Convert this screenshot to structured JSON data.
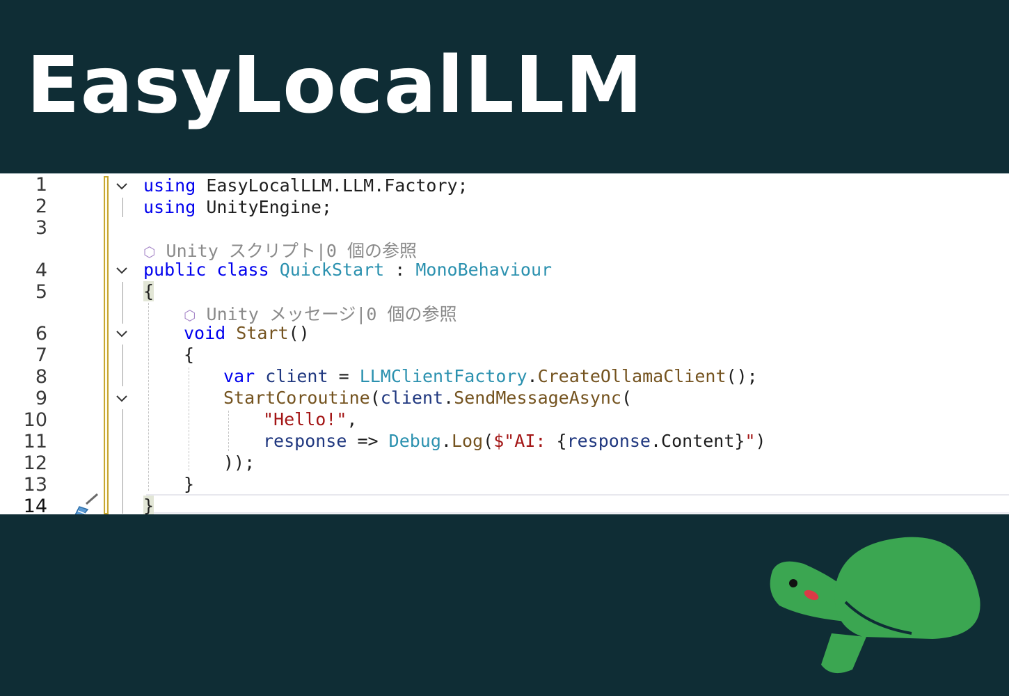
{
  "banner": {
    "title": "EasyLocalLLM"
  },
  "editor": {
    "line_numbers": [
      "1",
      "2",
      "3",
      "4",
      "5",
      "6",
      "7",
      "8",
      "9",
      "10",
      "11",
      "12",
      "13",
      "14"
    ],
    "lens": {
      "class_refs": "Unity スクリプト|0 個の参照",
      "method_refs": "Unity メッセージ|0 個の参照"
    },
    "code": {
      "l1": {
        "kw": "using",
        "rest": " EasyLocalLLM.LLM.Factory;"
      },
      "l2": {
        "kw": "using",
        "rest": " UnityEngine;"
      },
      "l4": {
        "kw1": "public",
        "kw2": "class",
        "cls": "QuickStart",
        "colon": " : ",
        "base": "MonoBehaviour"
      },
      "l5": {
        "brace": "{"
      },
      "l6": {
        "kw": "void",
        "method": "Start",
        "parens": "()"
      },
      "l7": {
        "brace": "{"
      },
      "l8": {
        "kw": "var",
        "var": "client",
        "eq": " = ",
        "type": "LLMClientFactory",
        "dot": ".",
        "method": "CreateOllamaClient",
        "end": "();"
      },
      "l9": {
        "method": "StartCoroutine",
        "open": "(",
        "var": "client",
        "dot": ".",
        "method2": "SendMessageAsync",
        "open2": "("
      },
      "l10": {
        "str": "\"Hello!\"",
        "comma": ","
      },
      "l11": {
        "param": "response",
        "arrow": " => ",
        "type": "Debug",
        "dot": ".",
        "method": "Log",
        "open": "(",
        "str": "$\"AI: ",
        "brace_open": "{",
        "param2": "response",
        "dot2": ".",
        "prop": "Content",
        "brace_close": "}",
        "str_end": "\"",
        "close": ")"
      },
      "l12": {
        "text": "));"
      },
      "l13": {
        "brace": "}"
      },
      "l14": {
        "brace": "}"
      }
    },
    "icons": [
      "chevron-down-icon",
      "unity-cube-icon",
      "brush-icon"
    ]
  },
  "mascot": {
    "icon": "turtle-icon",
    "shell_color": "#3ba651",
    "cheek_color": "#d93a46"
  },
  "colors": {
    "background": "#0f2d35",
    "keyword": "#0000ee",
    "type": "#2b91af",
    "method": "#74531f",
    "string": "#a31515",
    "parameter": "#1f377f"
  }
}
